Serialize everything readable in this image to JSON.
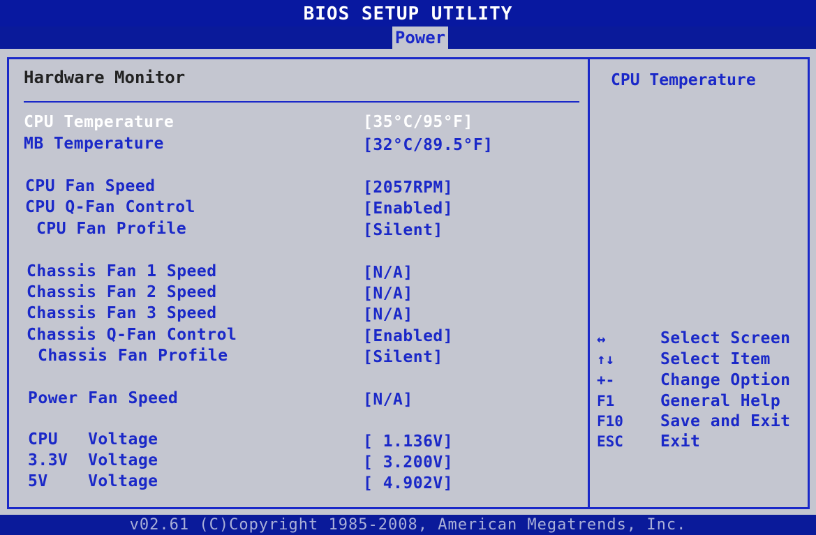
{
  "app_title": "BIOS SETUP UTILITY",
  "active_tab": "Power",
  "section_title": "Hardware Monitor",
  "settings": [
    {
      "label": "CPU Temperature",
      "value": "[35°C/95°F]",
      "selected": true
    },
    {
      "label": "MB Temperature",
      "value": "[32°C/89.5°F]"
    },
    {
      "label": "CPU Fan Speed",
      "value": "[2057RPM]"
    },
    {
      "label": "CPU Q-Fan Control",
      "value": "[Enabled]"
    },
    {
      "label": "CPU Fan Profile",
      "value": "[Silent]"
    },
    {
      "label": "Chassis Fan 1 Speed",
      "value": "[N/A]"
    },
    {
      "label": "Chassis Fan 2 Speed",
      "value": "[N/A]"
    },
    {
      "label": "Chassis Fan 3 Speed",
      "value": "[N/A]"
    },
    {
      "label": "Chassis Q-Fan Control",
      "value": "[Enabled]"
    },
    {
      "label": "Chassis Fan Profile",
      "value": "[Silent]"
    },
    {
      "label": "Power Fan Speed",
      "value": "[N/A]"
    },
    {
      "label": "CPU   Voltage",
      "value": "[ 1.136V]"
    },
    {
      "label": "3.3V  Voltage",
      "value": "[ 3.200V]"
    },
    {
      "label": "5V    Voltage",
      "value": "[ 4.902V]"
    }
  ],
  "help": {
    "title": "CPU Temperature",
    "keys": [
      {
        "key": "↔",
        "desc": "Select Screen"
      },
      {
        "key": "↑↓",
        "desc": "Select Item"
      },
      {
        "key": "+-",
        "desc": "Change Option"
      },
      {
        "key": "F1",
        "desc": "General Help"
      },
      {
        "key": "F10",
        "desc": "Save and Exit"
      },
      {
        "key": "ESC",
        "desc": "Exit"
      }
    ]
  },
  "footer": "v02.61 (C)Copyright 1985-2008, American Megatrends, Inc.",
  "colors": {
    "background_blue": "#0a1a9a",
    "panel_gray": "#c4c6d0",
    "text_blue": "#1a28c8",
    "selected_text": "#ffffff"
  }
}
